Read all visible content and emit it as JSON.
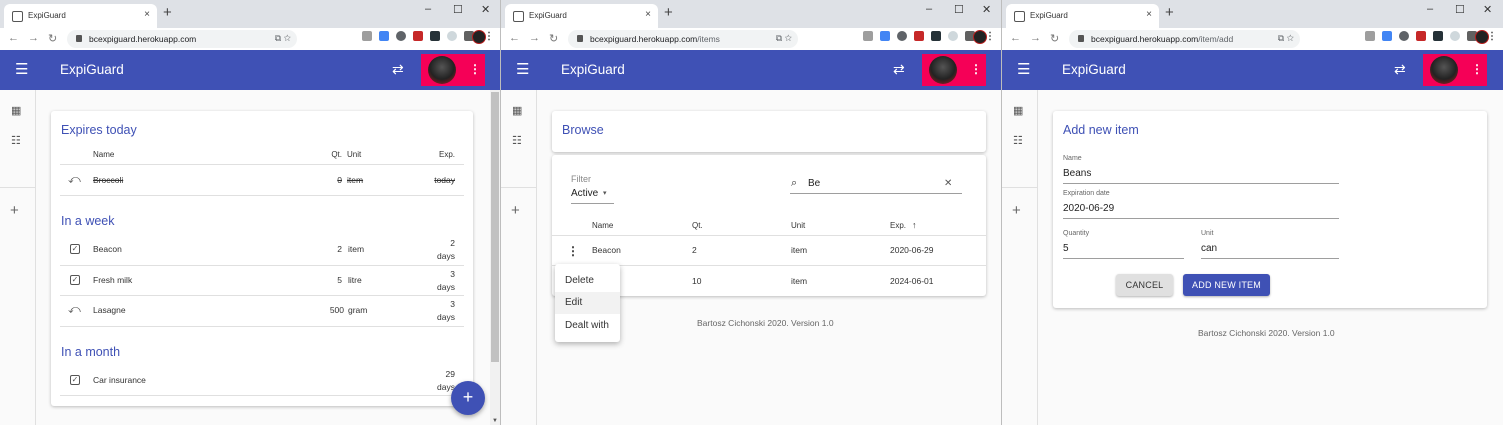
{
  "browser": {
    "tab_title": "ExpiGuard",
    "tab_close": "×",
    "new_tab": "+",
    "host": "bcexpiguard.herokuapp.com",
    "paths": [
      "",
      "/items",
      "/item/add"
    ],
    "window_controls": [
      "–",
      "☐",
      "✕"
    ]
  },
  "app": {
    "title": "ExpiGuard",
    "menu_icon": "☰",
    "swap_icon": "⇄",
    "user_menu_icon": "⋮",
    "accent_color": "#3f51b5",
    "user_color": "#f50057"
  },
  "sidebar": {
    "dashboard_icon": "▦",
    "list_icon": "☷",
    "add_icon": "+"
  },
  "dashboard": {
    "expires_today": {
      "title": "Expires today",
      "headers": {
        "name": "Name",
        "qty": "Qt.",
        "unit": "Unit",
        "exp": "Exp."
      },
      "rows": [
        {
          "name": "Broccoli",
          "qty": "0",
          "unit": "item",
          "exp": "today"
        }
      ]
    },
    "week": {
      "title": "In a week",
      "rows": [
        {
          "name": "Beacon",
          "qty": "2",
          "unit": "item",
          "exp1": "2",
          "exp2": "days"
        },
        {
          "name": "Fresh milk",
          "qty": "5",
          "unit": "litre",
          "exp1": "3",
          "exp2": "days"
        },
        {
          "name": "Lasagne",
          "qty": "500",
          "unit": "gram",
          "exp1": "3",
          "exp2": "days"
        }
      ]
    },
    "month": {
      "title": "In a month",
      "rows": [
        {
          "name": "Car insurance",
          "exp1": "29",
          "exp2": "days"
        }
      ]
    },
    "fab": "+"
  },
  "browse": {
    "title": "Browse",
    "filter_label": "Filter",
    "filter_value": "Active",
    "search_value": "Be",
    "search_clear": "✕",
    "headers": {
      "name": "Name",
      "qty": "Qt.",
      "unit": "Unit",
      "exp": "Exp."
    },
    "sort_arrow": "↑",
    "rows": [
      {
        "name": "Beacon",
        "qty": "2",
        "unit": "item",
        "exp": "2020-06-29"
      },
      {
        "qty": "10",
        "unit": "item",
        "exp": "2024-06-01"
      }
    ],
    "row_menu_icon": "⋮",
    "menu": [
      "Delete",
      "Edit",
      "Dealt with"
    ],
    "footer": "Bartosz Cichonski 2020. Version 1.0"
  },
  "add_item": {
    "title": "Add new item",
    "name_label": "Name",
    "name_value": "Beans",
    "date_label": "Expiration date",
    "date_value": "2020-06-29",
    "qty_label": "Quantity",
    "qty_value": "5",
    "unit_label": "Unit",
    "unit_value": "can",
    "cancel": "CANCEL",
    "submit": "ADD NEW ITEM",
    "footer": "Bartosz Cichonski 2020. Version 1.0"
  }
}
